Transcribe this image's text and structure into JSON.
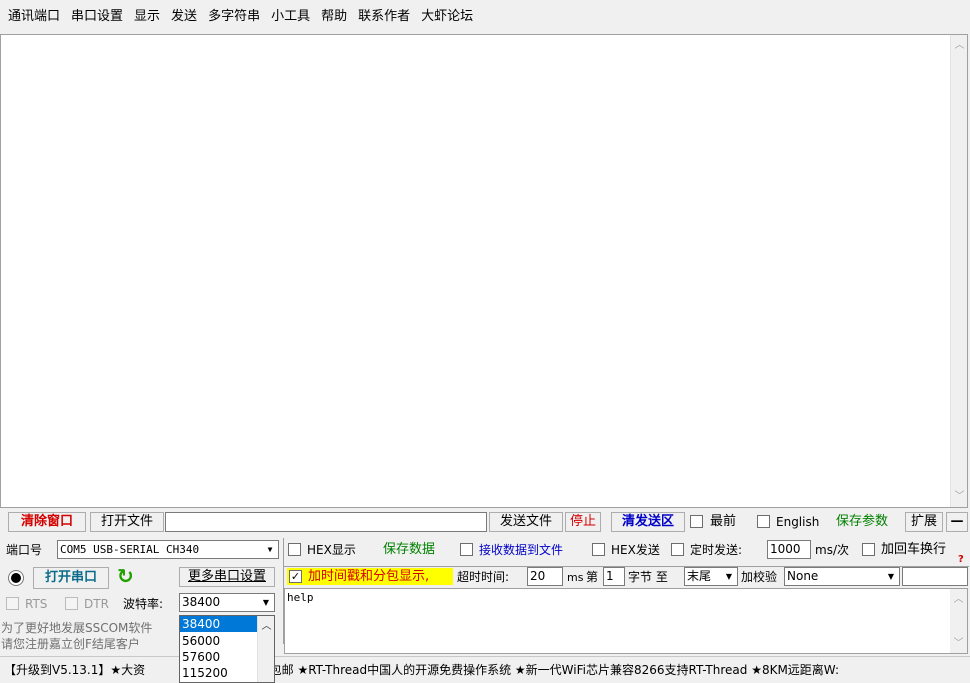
{
  "menu": [
    "通讯端口",
    "串口设置",
    "显示",
    "发送",
    "多字符串",
    "小工具",
    "帮助",
    "联系作者",
    "大虾论坛"
  ],
  "toolbar1": {
    "clear_window": "清除窗口",
    "open_file": "打开文件",
    "send_file": "发送文件",
    "stop": "停止",
    "clear_send": "清发送区",
    "topmost": "最前",
    "english": "English",
    "save_params": "保存参数",
    "expand": "扩展",
    "collapse": "—"
  },
  "port": {
    "label": "端口号",
    "value": "COM5 USB-SERIAL CH340",
    "open_button": "打开串口",
    "more_settings": "更多串口设置",
    "rts": "RTS",
    "dtr": "DTR",
    "baud_label": "波特率:",
    "baud_value": "38400",
    "baud_options": [
      "38400",
      "56000",
      "57600",
      "115200"
    ]
  },
  "options": {
    "hex_display": "HEX显示",
    "save_data": "保存数据",
    "recv_to_file": "接收数据到文件",
    "hex_send": "HEX发送",
    "timed_send": "定时发送:",
    "interval": "1000",
    "interval_unit": "ms/次",
    "add_crlf": "加回车换行",
    "timestamp": "加时间戳和分包显示,",
    "timeout_label": "超时时间:",
    "timeout_value": "20",
    "ms": "ms",
    "di": "第",
    "byte_index": "1",
    "byte_to": "字节 至",
    "tail": "末尾",
    "checksum_label": "加校验",
    "checksum": "None",
    "warn_mark": "?"
  },
  "send_text": "help",
  "promo_lines": [
    "为了更好地发展SSCOM软件",
    "请您注册嘉立创F结尾客户"
  ],
  "ticker": "【升级到V5.13.1】★大资",
  "ticker_right": "9包邮 ★RT-Thread中国人的开源免费操作系统 ★新一代WiFi芯片兼容8266支持RT-Thread ★8KM远距离W:",
  "icons": {
    "record": "record-icon",
    "refresh": "refresh-icon"
  },
  "colors": {
    "refresh_green": "#22a000",
    "highlight_blue": "#0078d7"
  }
}
